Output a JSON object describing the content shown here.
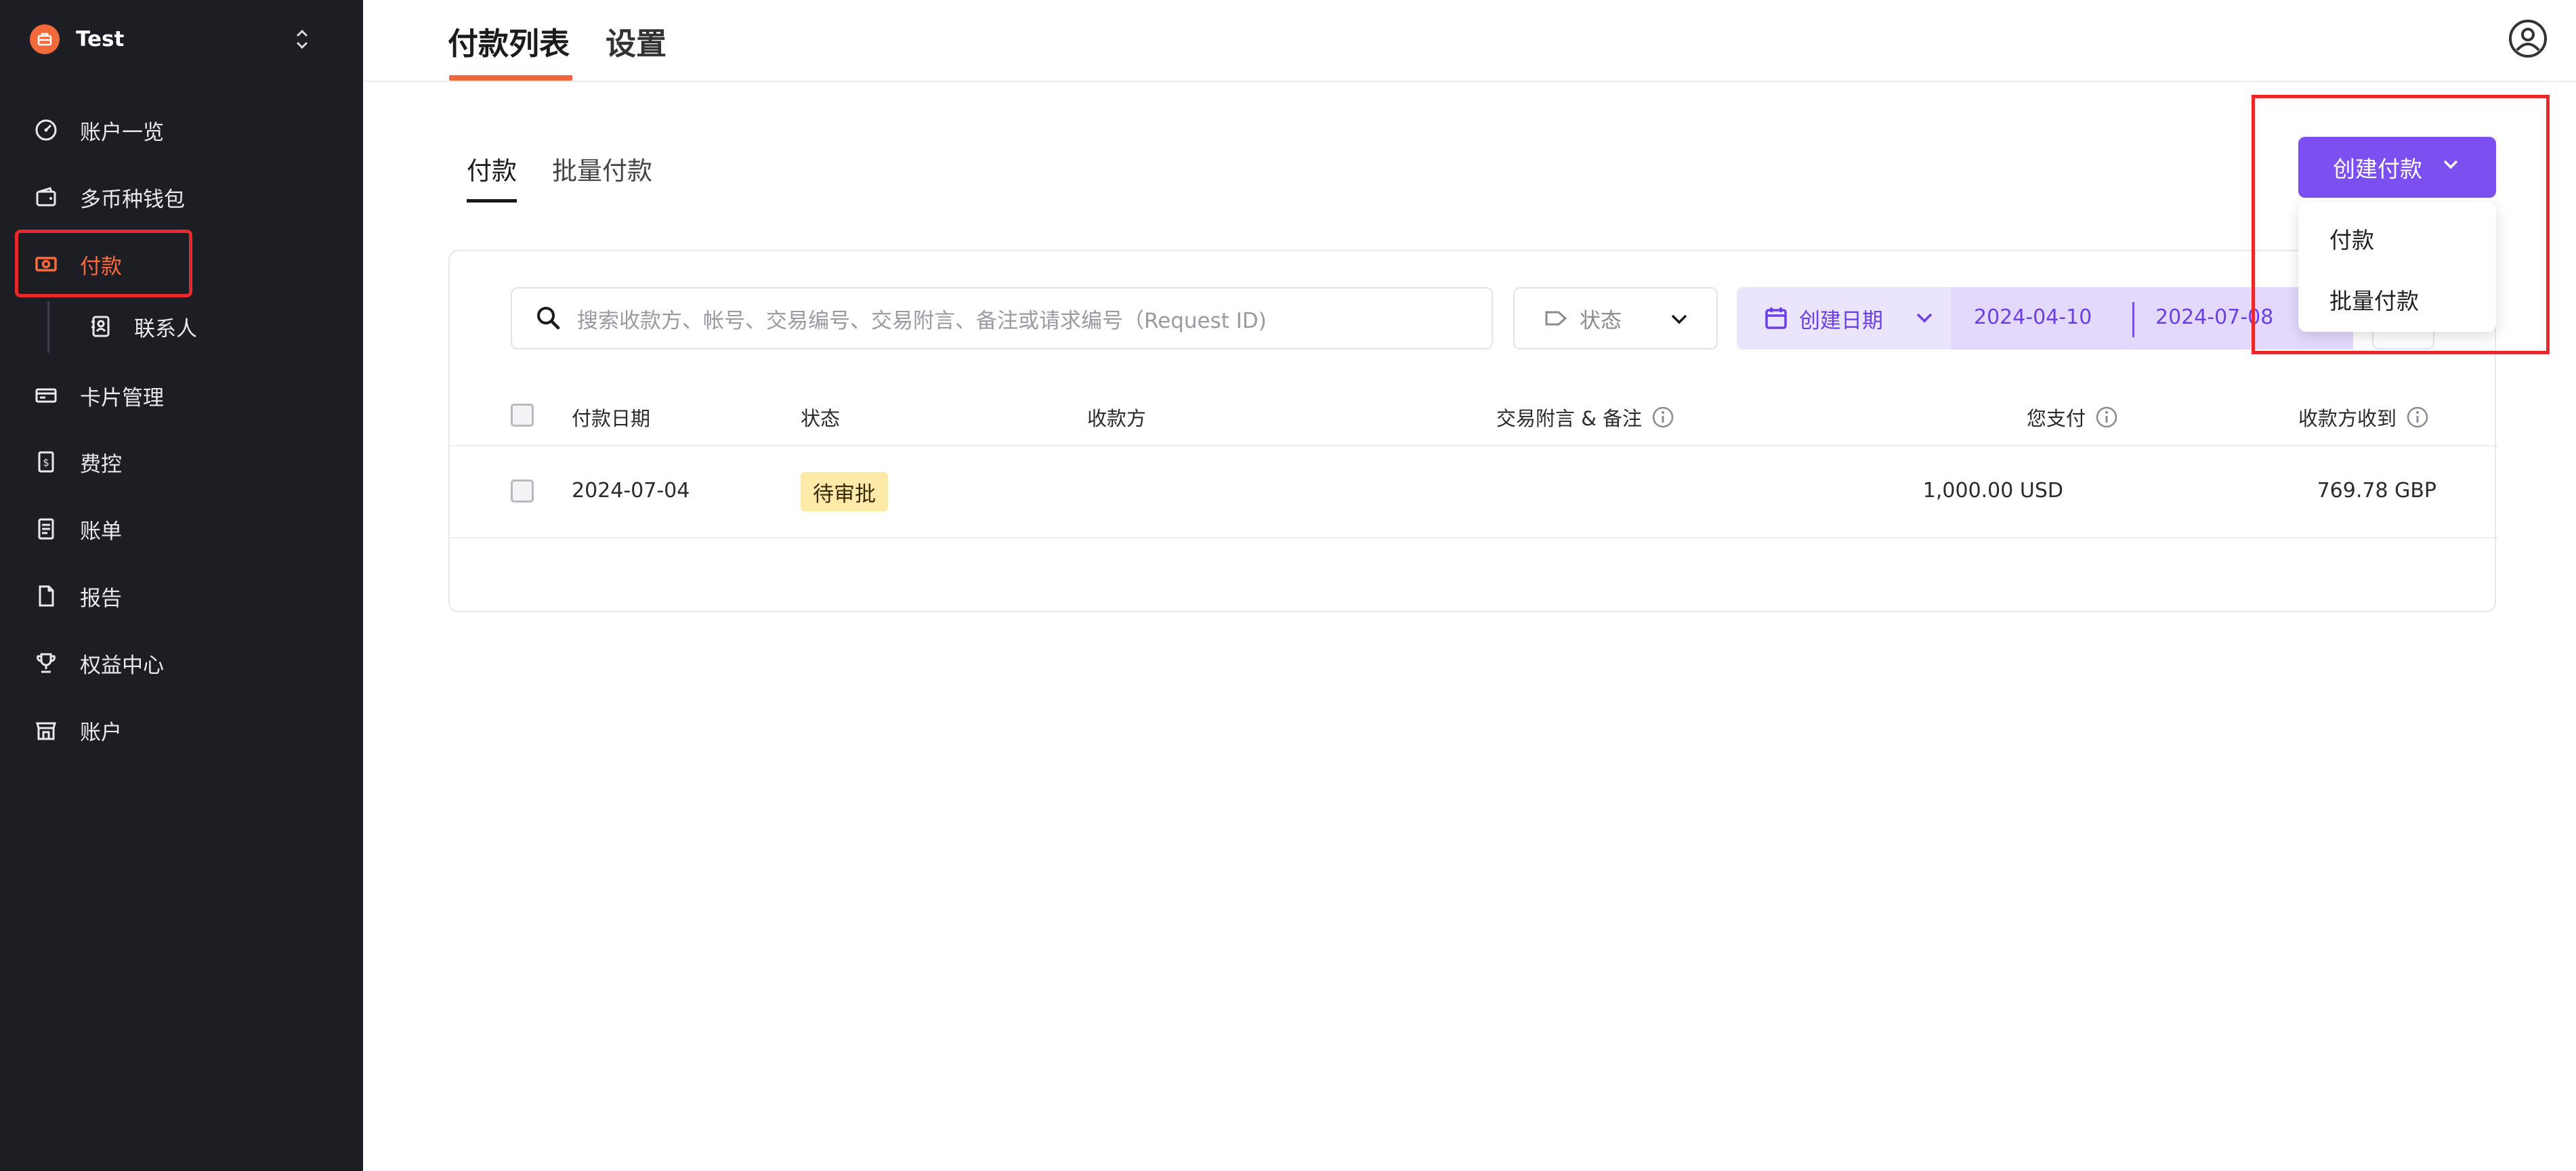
{
  "sidebar": {
    "workspace": {
      "name": "Test"
    },
    "items": [
      {
        "label": "账户一览",
        "icon": "dashboard-icon"
      },
      {
        "label": "多币种钱包",
        "icon": "wallet-icon"
      },
      {
        "label": "付款",
        "icon": "payment-icon",
        "active": true
      },
      {
        "label": "联系人",
        "icon": "contacts-icon",
        "sub": true
      },
      {
        "label": "卡片管理",
        "icon": "card-icon"
      },
      {
        "label": "费控",
        "icon": "expense-icon"
      },
      {
        "label": "账单",
        "icon": "bill-icon"
      },
      {
        "label": "报告",
        "icon": "report-icon"
      },
      {
        "label": "权益中心",
        "icon": "trophy-icon"
      },
      {
        "label": "账户",
        "icon": "store-icon"
      }
    ]
  },
  "header": {
    "tabs": [
      {
        "label": "付款列表",
        "active": true
      },
      {
        "label": "设置"
      }
    ]
  },
  "subtabs": [
    {
      "label": "付款",
      "active": true
    },
    {
      "label": "批量付款"
    }
  ],
  "create": {
    "label": "创建付款",
    "menu": [
      "付款",
      "批量付款"
    ]
  },
  "filters": {
    "search_placeholder": "搜索收款方、帐号、交易编号、交易附言、备注或请求编号（Request ID)",
    "status_label": "状态",
    "date_label": "创建日期",
    "date_from": "2024-04-10",
    "date_to": "2024-07-08"
  },
  "table": {
    "columns": [
      "付款日期",
      "状态",
      "收款方",
      "交易附言 & 备注",
      "您支付",
      "收款方收到"
    ],
    "rows": [
      {
        "date": "2024-07-04",
        "status": "待审批",
        "payee": "",
        "memo": "",
        "you_pay": "1,000.00 USD",
        "payee_receives": "769.78 GBP"
      }
    ]
  },
  "colors": {
    "sidebar_bg": "#1c1e24",
    "accent_orange": "#f4653a",
    "primary_purple": "#7b4ff0",
    "pending_badge": "#fde9a8"
  }
}
